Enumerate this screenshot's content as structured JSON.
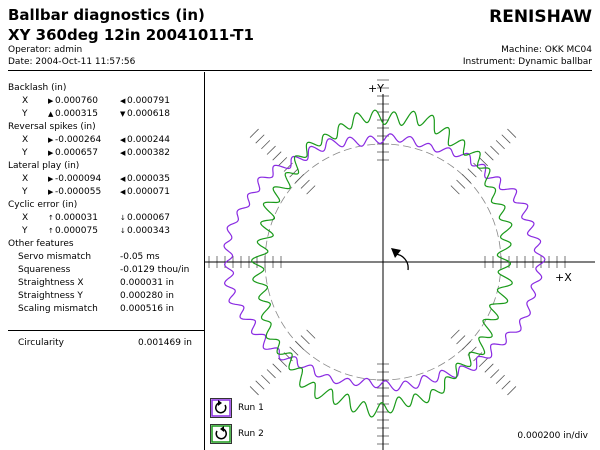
{
  "header": {
    "title_line1": "Ballbar diagnostics (in)",
    "title_line2": "XY 360deg 12in 20041011-T1",
    "logo": "RENISHAW",
    "operator": "Operator: admin",
    "date": "Date: 2004-Oct-11 11:57:56",
    "machine": "Machine: OKK MC04",
    "instrument": "Instrument: Dynamic ballbar"
  },
  "diagnostics": {
    "backlash": {
      "label": "Backlash (in)",
      "x": {
        "axis": "X",
        "v1": "0.000760",
        "v2": "0.000791"
      },
      "y": {
        "axis": "Y",
        "v1": "0.000315",
        "v2": "0.000618"
      }
    },
    "reversal_spikes": {
      "label": "Reversal spikes (in)",
      "x": {
        "axis": "X",
        "v1": "-0.000264",
        "v2": "0.000244"
      },
      "y": {
        "axis": "Y",
        "v1": "0.000657",
        "v2": "0.000382"
      }
    },
    "lateral_play": {
      "label": "Lateral play (in)",
      "x": {
        "axis": "X",
        "v1": "-0.000094",
        "v2": "0.000035"
      },
      "y": {
        "axis": "Y",
        "v1": "-0.000055",
        "v2": "0.000071"
      }
    },
    "cyclic_error": {
      "label": "Cyclic error (in)",
      "x": {
        "axis": "X",
        "v1": "0.000031",
        "v2": "0.000067"
      },
      "y": {
        "axis": "Y",
        "v1": "0.000075",
        "v2": "0.000343"
      }
    },
    "other_features": {
      "label": "Other features",
      "servo_mismatch": {
        "label": "Servo mismatch",
        "value": "-0.05 ms"
      },
      "squareness": {
        "label": "Squareness",
        "value": "-0.0129 thou/in"
      },
      "straightness_x": {
        "label": "Straightness X",
        "value": "0.000031 in"
      },
      "straightness_y": {
        "label": "Straightness Y",
        "value": "0.000280 in"
      },
      "scaling_mismatch": {
        "label": "Scaling mismatch",
        "value": "0.000516 in"
      }
    },
    "circularity": {
      "label": "Circularity",
      "value": "0.001469 in"
    }
  },
  "plot": {
    "y_axis_label": "+Y",
    "x_axis_label": "+X",
    "scale": "0.000200 in/div",
    "run1_color": "#8a2be2",
    "run2_color": "#1a9a1a"
  },
  "legend": {
    "run1": {
      "label": "Run 1",
      "icon": "clockwise-arrow-icon"
    },
    "run2": {
      "label": "Run 2",
      "icon": "counterclockwise-arrow-icon"
    }
  }
}
